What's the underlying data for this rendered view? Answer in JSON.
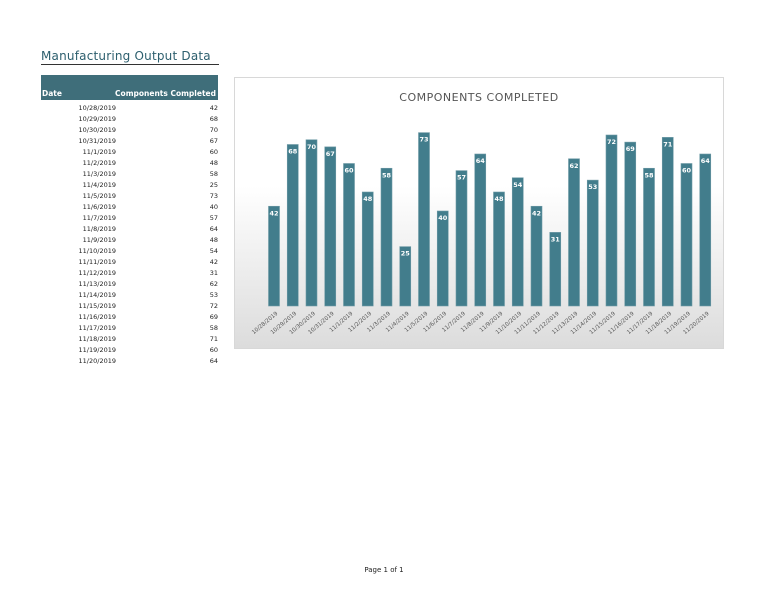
{
  "title": "Manufacturing Output Data",
  "table": {
    "headers": [
      "Date",
      "Components Completed"
    ],
    "rows": [
      [
        "10/28/2019",
        "42"
      ],
      [
        "10/29/2019",
        "68"
      ],
      [
        "10/30/2019",
        "70"
      ],
      [
        "10/31/2019",
        "67"
      ],
      [
        "11/1/2019",
        "60"
      ],
      [
        "11/2/2019",
        "48"
      ],
      [
        "11/3/2019",
        "58"
      ],
      [
        "11/4/2019",
        "25"
      ],
      [
        "11/5/2019",
        "73"
      ],
      [
        "11/6/2019",
        "40"
      ],
      [
        "11/7/2019",
        "57"
      ],
      [
        "11/8/2019",
        "64"
      ],
      [
        "11/9/2019",
        "48"
      ],
      [
        "11/10/2019",
        "54"
      ],
      [
        "11/11/2019",
        "42"
      ],
      [
        "11/12/2019",
        "31"
      ],
      [
        "11/13/2019",
        "62"
      ],
      [
        "11/14/2019",
        "53"
      ],
      [
        "11/15/2019",
        "72"
      ],
      [
        "11/16/2019",
        "69"
      ],
      [
        "11/17/2019",
        "58"
      ],
      [
        "11/18/2019",
        "71"
      ],
      [
        "11/19/2019",
        "60"
      ],
      [
        "11/20/2019",
        "64"
      ]
    ]
  },
  "chart_data": {
    "type": "bar",
    "title": "COMPONENTS COMPLETED",
    "categories": [
      "10/28/2019",
      "10/29/2019",
      "10/30/2019",
      "10/31/2019",
      "11/1/2019",
      "11/2/2019",
      "11/3/2019",
      "11/4/2019",
      "11/5/2019",
      "11/6/2019",
      "11/7/2019",
      "11/8/2019",
      "11/9/2019",
      "11/10/2019",
      "11/11/2019",
      "11/12/2019",
      "11/13/2019",
      "11/14/2019",
      "11/15/2019",
      "11/16/2019",
      "11/17/2019",
      "11/18/2019",
      "11/19/2019",
      "11/20/2019"
    ],
    "values": [
      42,
      68,
      70,
      67,
      60,
      48,
      58,
      25,
      73,
      40,
      57,
      64,
      48,
      54,
      42,
      31,
      62,
      53,
      72,
      69,
      58,
      71,
      60,
      64
    ],
    "xlabel": "",
    "ylabel": "",
    "ylim": [
      0,
      80
    ],
    "grid": false,
    "bar_color": "#427d8c"
  },
  "footer": "Page 1 of 1"
}
